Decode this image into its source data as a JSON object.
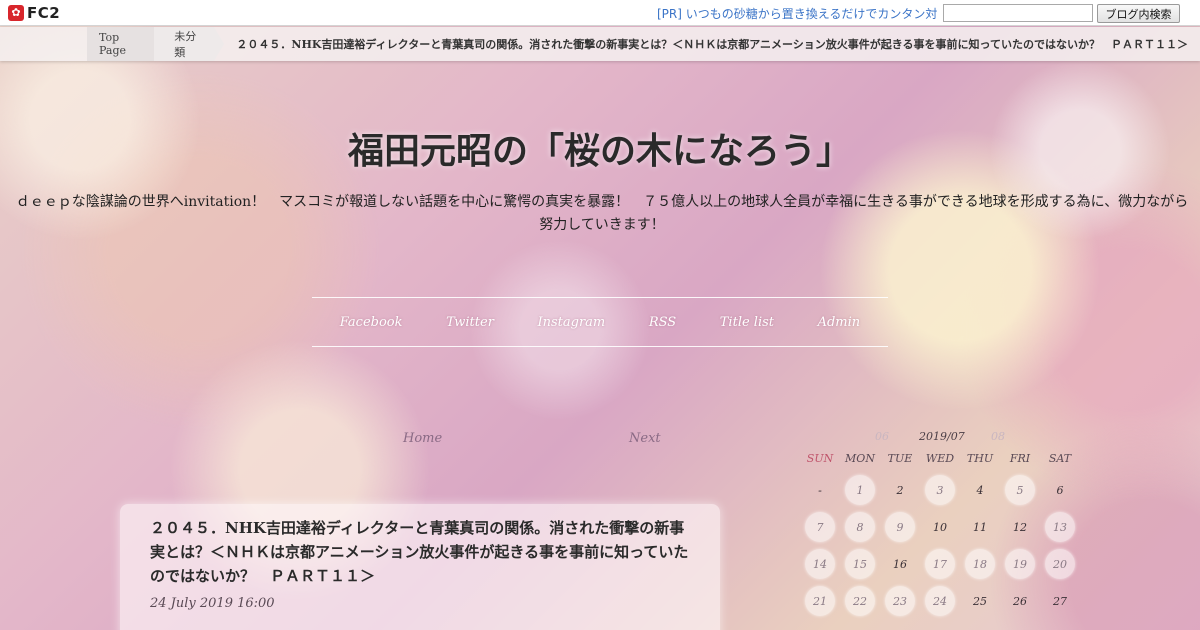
{
  "fc2bar": {
    "logo_text": "FC2",
    "pr_link": "[PR] いつもの砂糖から置き換えるだけでカンタン対",
    "search_placeholder": "",
    "search_button": "ブログ内検索"
  },
  "breadcrumb": {
    "top": "Top Page",
    "category": "未分類",
    "current": "２０４５．NHK吉田達裕ディレクターと青葉真司の関係。消された衝撃の新事実とは？＜ＮＨＫは京都アニメーション放火事件が起きる事を事前に知っていたのではないか？　ＰＡＲＴ１１＞"
  },
  "header": {
    "title": "福田元昭の「桜の木になろう」",
    "description": "ｄｅｅｐな陰謀論の世界へinvitation！　マスコミが報道しない話題を中心に驚愕の真実を暴露！　７５億人以上の地球人全員が幸福に生きる事ができる地球を形成する為に、微力ながら努力していきます！"
  },
  "nav": [
    "Facebook",
    "Twitter",
    "Instagram",
    "RSS",
    "Title list",
    "Admin"
  ],
  "pager": {
    "home": "Home",
    "next": "Next"
  },
  "entry": {
    "title": "２０４５．NHK吉田達裕ディレクターと青葉真司の関係。消された衝撃の新事実とは？＜ＮＨＫは京都アニメーション放火事件が起きる事を事前に知っていたのではないか？　ＰＡＲＴ１１＞",
    "date": "24 July 2019 16:00"
  },
  "calendar": {
    "prev": "06",
    "month": "2019/07",
    "next": "08",
    "weekdays": [
      "SUN",
      "MON",
      "TUE",
      "WED",
      "THU",
      "FRI",
      "SAT"
    ],
    "days": [
      {
        "d": "-",
        "link": false
      },
      {
        "d": "1",
        "link": true
      },
      {
        "d": "2",
        "link": false
      },
      {
        "d": "3",
        "link": true
      },
      {
        "d": "4",
        "link": false
      },
      {
        "d": "5",
        "link": true
      },
      {
        "d": "6",
        "link": false
      },
      {
        "d": "7",
        "link": true
      },
      {
        "d": "8",
        "link": true
      },
      {
        "d": "9",
        "link": true
      },
      {
        "d": "10",
        "link": false
      },
      {
        "d": "11",
        "link": false
      },
      {
        "d": "12",
        "link": false
      },
      {
        "d": "13",
        "link": true
      },
      {
        "d": "14",
        "link": true
      },
      {
        "d": "15",
        "link": true
      },
      {
        "d": "16",
        "link": false
      },
      {
        "d": "17",
        "link": true
      },
      {
        "d": "18",
        "link": true
      },
      {
        "d": "19",
        "link": true
      },
      {
        "d": "20",
        "link": true
      },
      {
        "d": "21",
        "link": true
      },
      {
        "d": "22",
        "link": true
      },
      {
        "d": "23",
        "link": true
      },
      {
        "d": "24",
        "link": true
      },
      {
        "d": "25",
        "link": false
      },
      {
        "d": "26",
        "link": false
      },
      {
        "d": "27",
        "link": false
      }
    ]
  }
}
